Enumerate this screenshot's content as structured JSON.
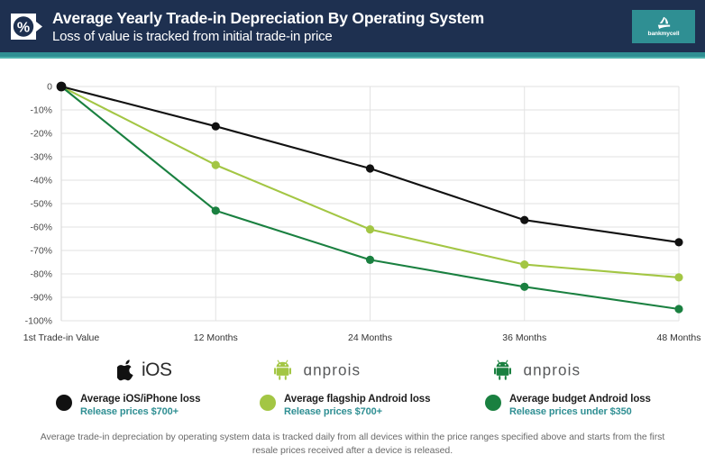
{
  "header": {
    "title": "Average Yearly Trade-in Depreciation By Operating System",
    "subtitle": "Loss of value is tracked from initial trade-in price",
    "badge_symbol": "%",
    "logo_text": "bankmycell",
    "bg_color": "#1e3050",
    "accent_color": "#2f8f93"
  },
  "chart_data": {
    "type": "line",
    "title": "Average Yearly Trade-in Depreciation By Operating System",
    "subtitle": "Loss of value is tracked from initial trade-in price",
    "xlabel": "",
    "ylabel": "",
    "categories": [
      "1st Trade-in Value",
      "12 Months",
      "24 Months",
      "36 Months",
      "48 Months"
    ],
    "ylim": [
      -100,
      0
    ],
    "yticks": [
      0,
      -10,
      -20,
      -30,
      -40,
      -50,
      -60,
      -70,
      -80,
      -90,
      -100
    ],
    "ytick_labels": [
      "0",
      "-10%",
      "-20%",
      "-30%",
      "-40%",
      "-50%",
      "-60%",
      "-70%",
      "-80%",
      "-90%",
      "-100%"
    ],
    "grid": true,
    "legend_position": "bottom",
    "series": [
      {
        "name": "Average iOS/iPhone loss",
        "sublabel": "Release prices $700+",
        "color": "#111111",
        "values": [
          0,
          -17,
          -35,
          -57,
          -66.5
        ]
      },
      {
        "name": "Average flagship Android loss",
        "sublabel": "Release prices $700+",
        "color": "#a3c644",
        "values": [
          0,
          -33.5,
          -61,
          -76,
          -81.5
        ]
      },
      {
        "name": "Average budget Android loss",
        "sublabel": "Release prices under $350",
        "color": "#1a8040",
        "values": [
          0,
          -53,
          -74,
          -85.5,
          -95
        ]
      }
    ]
  },
  "os_row": [
    {
      "icon": "apple-icon",
      "label": "iOS",
      "icon_color": "#111111",
      "label_color": "#2b2b2b"
    },
    {
      "icon": "android-icon",
      "label": "android",
      "icon_color": "#a3c644",
      "label_color": "#58595b"
    },
    {
      "icon": "android-icon",
      "label": "android",
      "icon_color": "#1a8040",
      "label_color": "#58595b"
    }
  ],
  "legend": [
    {
      "title": "Average iOS/iPhone loss",
      "sub": "Release prices $700+",
      "color": "#111111"
    },
    {
      "title": "Average flagship Android loss",
      "sub": "Release prices $700+",
      "color": "#a3c644"
    },
    {
      "title": "Average budget Android loss",
      "sub": "Release prices under $350",
      "color": "#1a8040"
    }
  ],
  "footer": {
    "note": "Average trade-in depreciation by operating system data is tracked daily from all devices within the price ranges specified above and starts from the first resale prices received after a device is released."
  }
}
